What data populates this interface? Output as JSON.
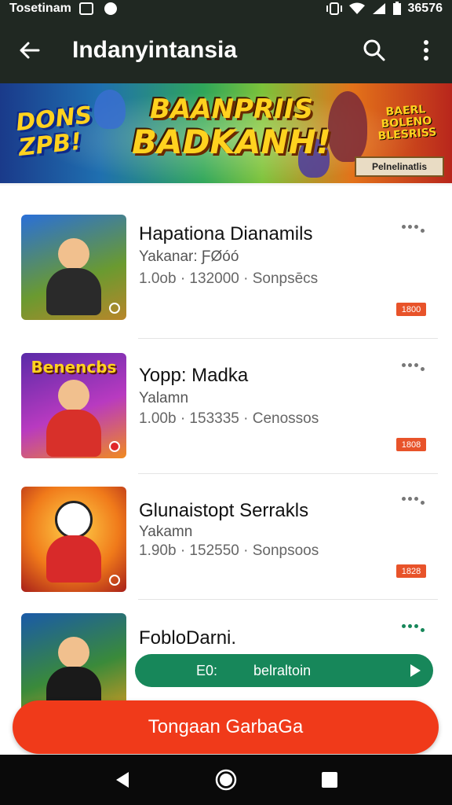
{
  "status_bar": {
    "app_name": "Tosetinam",
    "time": "36576"
  },
  "app_bar": {
    "title": "Indanyintansia"
  },
  "banner": {
    "left_text_1": "DONS",
    "left_text_2": "ZPB!",
    "title_line1": "BAANPRIIS",
    "title_line2": "BADKANH!",
    "right_text": "BAERL BOLENO BLESRISS",
    "badge_text": "Pelnelinatlis"
  },
  "rows": [
    {
      "title": "Hapationa Dianamils",
      "subtitle": "Yakanar: ƑØóó",
      "meta": "1.0ob · 132000 · Sonpsēcs",
      "badge": "1800",
      "thumb_title": ""
    },
    {
      "title": "Yopp: Madka",
      "subtitle": "Yalamn",
      "meta": "1.00b · 153335 · Cenossos",
      "badge": "1808",
      "thumb_title": "Benencbs"
    },
    {
      "title": "Glunaistopt Serrakls",
      "subtitle": "Yakamn",
      "meta": "1.90b · 152550 · Sonpsoos",
      "badge": "1828",
      "thumb_title": ""
    }
  ],
  "row4": {
    "title": "FobloDarni.",
    "bar_left": "E0:",
    "bar_mid": "belraltoin"
  },
  "cta_label": "Tongaan GarbaGa",
  "colors": {
    "app_bar": "#202822",
    "cta": "#f03a1a",
    "green": "#17875a",
    "badge": "#e8532a"
  }
}
